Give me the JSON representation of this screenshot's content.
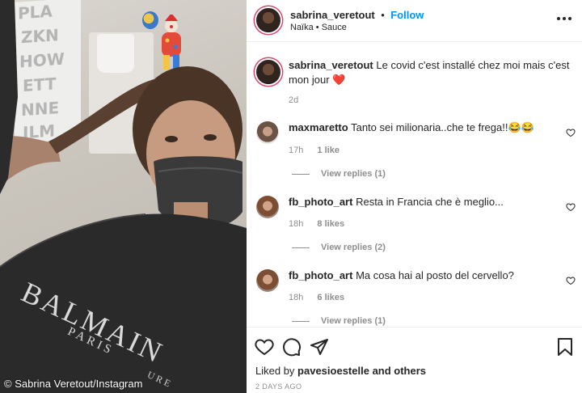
{
  "photo": {
    "credit": "© Sabrina Veretout/Instagram",
    "wall_letters": [
      "PLA",
      "ZKN",
      "HOW",
      "ETT",
      "NNE",
      "ILM"
    ],
    "cape_brand": "BALMAIN",
    "cape_city": "PARIS",
    "cape_extra": "URE"
  },
  "header": {
    "username": "sabrina_veretout",
    "separator": "•",
    "follow_label": "Follow",
    "audio": "Naïka • Sauce"
  },
  "caption": {
    "username": "sabrina_veretout",
    "text": "Le covid c'est installé chez moi mais c'est mon jour",
    "emoji": "❤️",
    "time": "2d"
  },
  "comments": [
    {
      "username": "maxmaretto",
      "text": "Tanto sei milionaria..che te frega!!😂😂",
      "time": "17h",
      "likes": "1 like",
      "replies": "View replies (1)"
    },
    {
      "username": "fb_photo_art",
      "text": "Resta in Francia che è meglio...",
      "time": "18h",
      "likes": "8 likes",
      "replies": "View replies (2)"
    },
    {
      "username": "fb_photo_art",
      "text": "Ma cosa hai al posto del cervello?",
      "time": "18h",
      "likes": "6 likes",
      "replies": "View replies (1)"
    }
  ],
  "footer": {
    "liked_by_prefix": "Liked by",
    "liked_by_user": "pavesioestelle",
    "liked_by_suffix": "and others",
    "time_ago": "2 DAYS AGO"
  },
  "colors": {
    "link_blue": "#0095f6",
    "text": "#262626",
    "muted": "#8e8e8e"
  }
}
